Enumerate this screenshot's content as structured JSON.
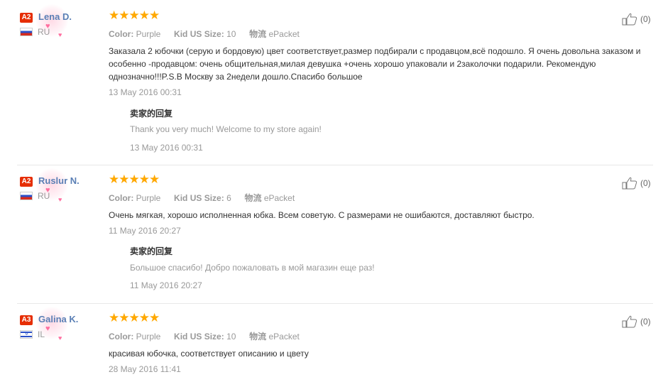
{
  "reviews": [
    {
      "badge": "A2",
      "name": "Lena D.",
      "country": "RU",
      "rating_stars": "★★★★★",
      "rating": 5,
      "color_label": "Color:",
      "color_value": "Purple",
      "size_label": "Kid US Size:",
      "size_value": "10",
      "shipping_label": "物流",
      "shipping_value": "ePacket",
      "text": "Заказала 2 юбочки (серую и бордовую) цвет соответствует,размер подбирали с продавцом,всё подошло. Я очень довольна заказом и особенно -продавцом: очень общительная,милая девушка +очень хорошо упаковали и 2заколочки подарили. Рекомендую однозначно!!!P.S.В Москву за 2недели дошло.Спасибо большое",
      "date": "13 May 2016 00:31",
      "useful_count": "(0)",
      "reply": {
        "title": "卖家的回复",
        "text": "Thank you very much! Welcome to my store again!",
        "date": "13 May 2016 00:31"
      }
    },
    {
      "badge": "A2",
      "name": "Ruslur N.",
      "country": "RU",
      "rating_stars": "★★★★★",
      "rating": 5,
      "color_label": "Color:",
      "color_value": "Purple",
      "size_label": "Kid US Size:",
      "size_value": "6",
      "shipping_label": "物流",
      "shipping_value": "ePacket",
      "text": "Очень мягкая, хорошо исполненная юбка. Всем советую. С размерами не ошибаются, доставляют быстро.",
      "date": "11 May 2016 20:27",
      "useful_count": "(0)",
      "reply": {
        "title": "卖家的回复",
        "text": "Большое спасибо! Добро пожаловать в мой магазин еще раз!",
        "date": "11 May 2016 20:27"
      }
    },
    {
      "badge": "A3",
      "name": "Galina K.",
      "country": "IL",
      "rating_stars": "★★★★★",
      "rating": 5,
      "color_label": "Color:",
      "color_value": "Purple",
      "size_label": "Kid US Size:",
      "size_value": "10",
      "shipping_label": "物流",
      "shipping_value": "ePacket",
      "text": "красивая юбочка, соответствует описанию и цвету",
      "date": "28 May 2016 11:41",
      "useful_count": "(0)"
    }
  ],
  "colors": {
    "star": "#ffa800",
    "badge": "#e62e04",
    "name": "#5a7fb5",
    "muted": "#999999"
  }
}
